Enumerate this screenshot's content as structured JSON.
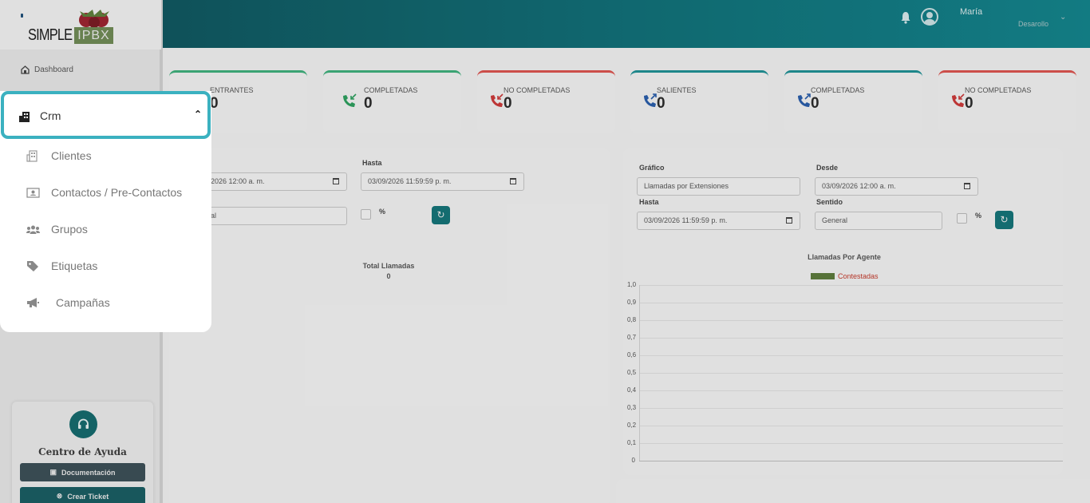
{
  "header": {
    "user_name": "María",
    "user_role": "Desarollo"
  },
  "sidebar": {
    "logo_text": "SIMPLE",
    "logo_badge": "IPBX",
    "dashboard_label": "Dashboard",
    "help": {
      "title": "Centro de Ayuda",
      "docs_label": "Documentación",
      "ticket_label": "Crear Ticket"
    }
  },
  "menu": {
    "crm_label": "Crm",
    "items": [
      {
        "label": "Clientes",
        "icon": "building-icon"
      },
      {
        "label": "Contactos / Pre-Contactos",
        "icon": "contact-card-icon"
      },
      {
        "label": "Grupos",
        "icon": "users-icon"
      },
      {
        "label": "Etiquetas",
        "icon": "tag-icon"
      },
      {
        "label": "Campañas",
        "icon": "megaphone-icon"
      }
    ]
  },
  "stats": [
    {
      "label": "ENTRANTES",
      "value": "0"
    },
    {
      "label": "COMPLETADAS",
      "value": "0"
    },
    {
      "label": "NO COMPLETADAS",
      "value": "0"
    },
    {
      "label": "SALIENTES",
      "value": "0"
    },
    {
      "label": "COMPLETADAS",
      "value": "0"
    },
    {
      "label": "NO COMPLETADAS",
      "value": "0"
    }
  ],
  "left_panel": {
    "desde_value": "2026 12:00  a. m.",
    "hasta_label": "Hasta",
    "hasta_value": "03/09/2026 11:59:59  p. m.",
    "sentido_value": "al",
    "pct_label": "%",
    "total_label": "Total Llamadas",
    "total_value": "0"
  },
  "right_panel": {
    "grafico_label": "Gráfico",
    "grafico_value": "Llamadas por Extensiones",
    "desde_label": "Desde",
    "desde_value": "03/09/2026 12:00  a. m.",
    "hasta_label": "Hasta",
    "hasta_value": "03/09/2026 11:59:59  p. m.",
    "sentido_label": "Sentido",
    "sentido_value": "General",
    "pct_label": "%"
  },
  "chart_data": {
    "type": "bar",
    "title": "Llamadas Por Agente",
    "legend": "top",
    "series": [
      {
        "name": "Contestadas",
        "color": "#5c7a3c",
        "values": []
      }
    ],
    "categories": [],
    "ylim": [
      0,
      1
    ],
    "y_ticks": [
      "1,0",
      "0,9",
      "0,8",
      "0,7",
      "0,6",
      "0,5",
      "0,4",
      "0,3",
      "0,2",
      "0,1",
      "0"
    ],
    "grid": true
  }
}
